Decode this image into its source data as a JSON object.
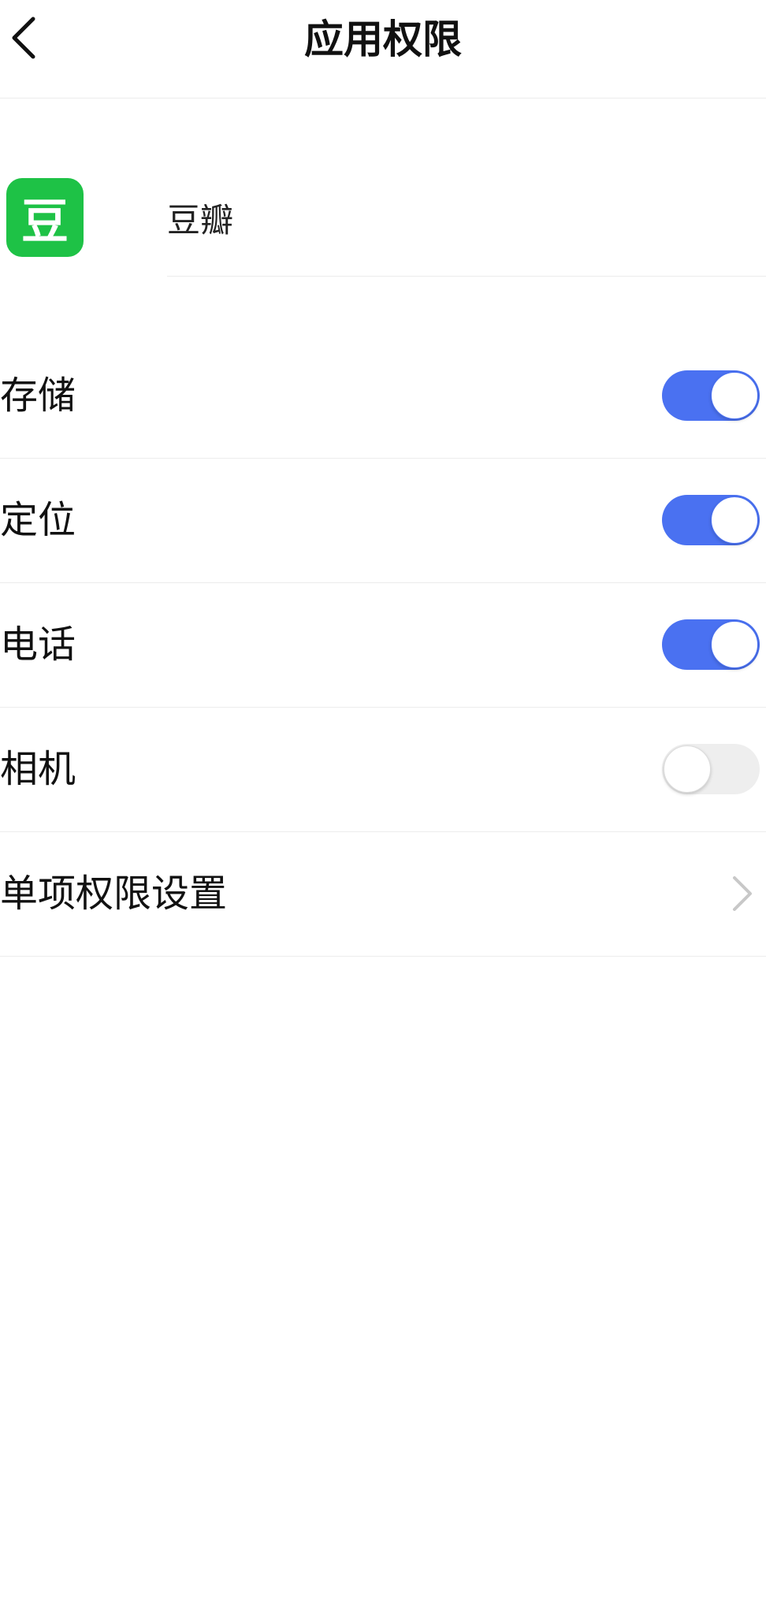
{
  "header": {
    "title": "应用权限",
    "back_icon": "chevron-left-icon"
  },
  "app": {
    "name": "豆瓣",
    "icon_glyph": "豆",
    "icon_color": "#1ec246"
  },
  "permissions": [
    {
      "label": "存储",
      "enabled": true
    },
    {
      "label": "定位",
      "enabled": true
    },
    {
      "label": "电话",
      "enabled": true
    },
    {
      "label": "相机",
      "enabled": false
    }
  ],
  "individual_settings": {
    "label": "单项权限设置",
    "icon": "chevron-right-icon"
  },
  "colors": {
    "toggle_on": "#4a71f1",
    "toggle_off": "#eeeeee"
  }
}
